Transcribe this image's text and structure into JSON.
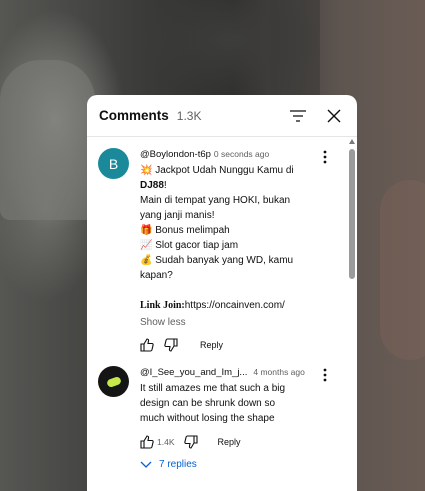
{
  "header": {
    "title": "Comments",
    "count": "1.3K"
  },
  "comments": [
    {
      "avatar_letter": "B",
      "author": "@Boylondon-t6p",
      "time": "0 seconds ago",
      "lines": [
        "💥 Jackpot Udah Nunggu Kamu di",
        "DJ88!",
        "Main di tempat yang HOKI, bukan",
        "yang janji manis!",
        "🎁 Bonus melimpah",
        "📈 Slot gacor tiap jam",
        "💰 Sudah banyak yang WD, kamu",
        "kapan?",
        "",
        "https://oncainven.com/"
      ],
      "line1_prefix": "💥 Jackpot Udah Nunggu Kamu di",
      "line2_bold": "DJ88",
      "line2_suffix": "!",
      "link_label": "Link Join:",
      "link_url": "https://oncainven.com/",
      "show_less": "Show less",
      "reply": "Reply"
    },
    {
      "author": "@I_See_you_and_Im_j...",
      "time": "4 months ago",
      "lines": [
        "It still amazes me that such a big",
        "design can be shrunk down so",
        "much without losing the shape"
      ],
      "likes": "1.4K",
      "reply": "Reply",
      "replies": "7 replies"
    }
  ],
  "colors": {
    "avatar": "#1a8a9a",
    "link": "#065fd4",
    "muted": "#606060"
  }
}
